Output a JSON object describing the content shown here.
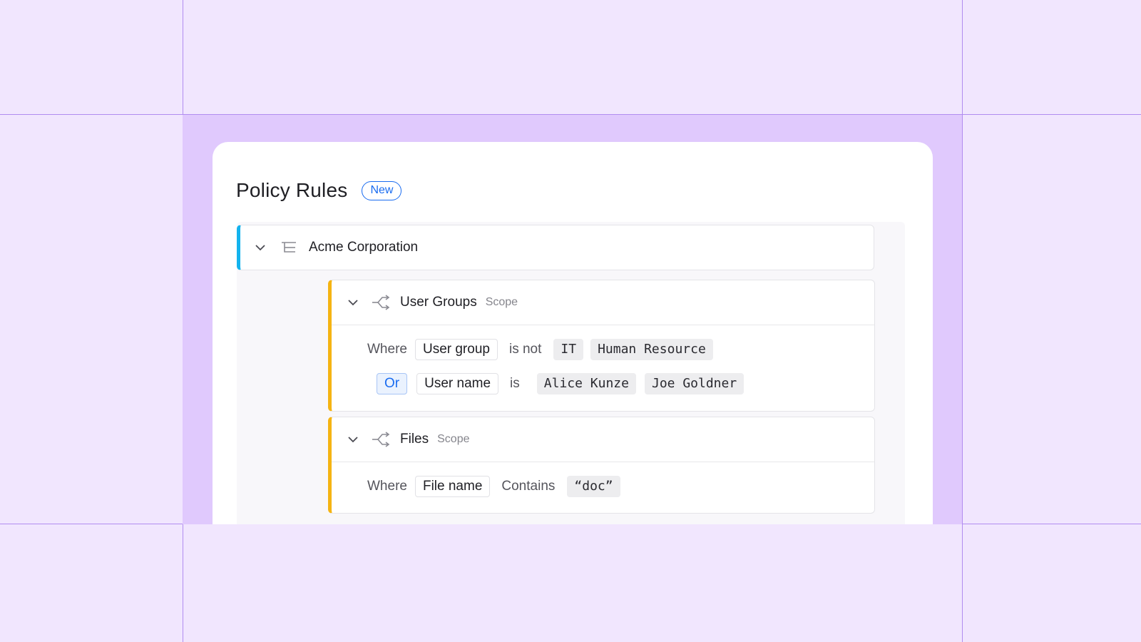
{
  "page": {
    "title": "Policy Rules",
    "badge": "New"
  },
  "org": {
    "name": "Acme Corporation",
    "accent_color": "#13b3ee",
    "icons": [
      "chevron-down-icon",
      "tree-icon"
    ]
  },
  "scopes": [
    {
      "name": "User Groups",
      "tag": "Scope",
      "accent_color": "#f5b412",
      "conditions": [
        {
          "connector": "Where",
          "field": "User group",
          "operator": "is not",
          "values": [
            "IT",
            "Human Resource"
          ]
        },
        {
          "connector": "Or",
          "field": "User name",
          "operator": "is",
          "values": [
            "Alice Kunze",
            "Joe Goldner"
          ]
        }
      ]
    },
    {
      "name": "Files",
      "tag": "Scope",
      "accent_color": "#f5b412",
      "conditions": [
        {
          "connector": "Where",
          "field": "File name",
          "operator": "Contains",
          "values": [
            "“doc”"
          ]
        }
      ]
    }
  ],
  "colors": {
    "background": "#f1e6fe",
    "frame": "#e0c9fd",
    "grid_lines": "#b18cf0",
    "link_blue": "#1a6cf0"
  }
}
